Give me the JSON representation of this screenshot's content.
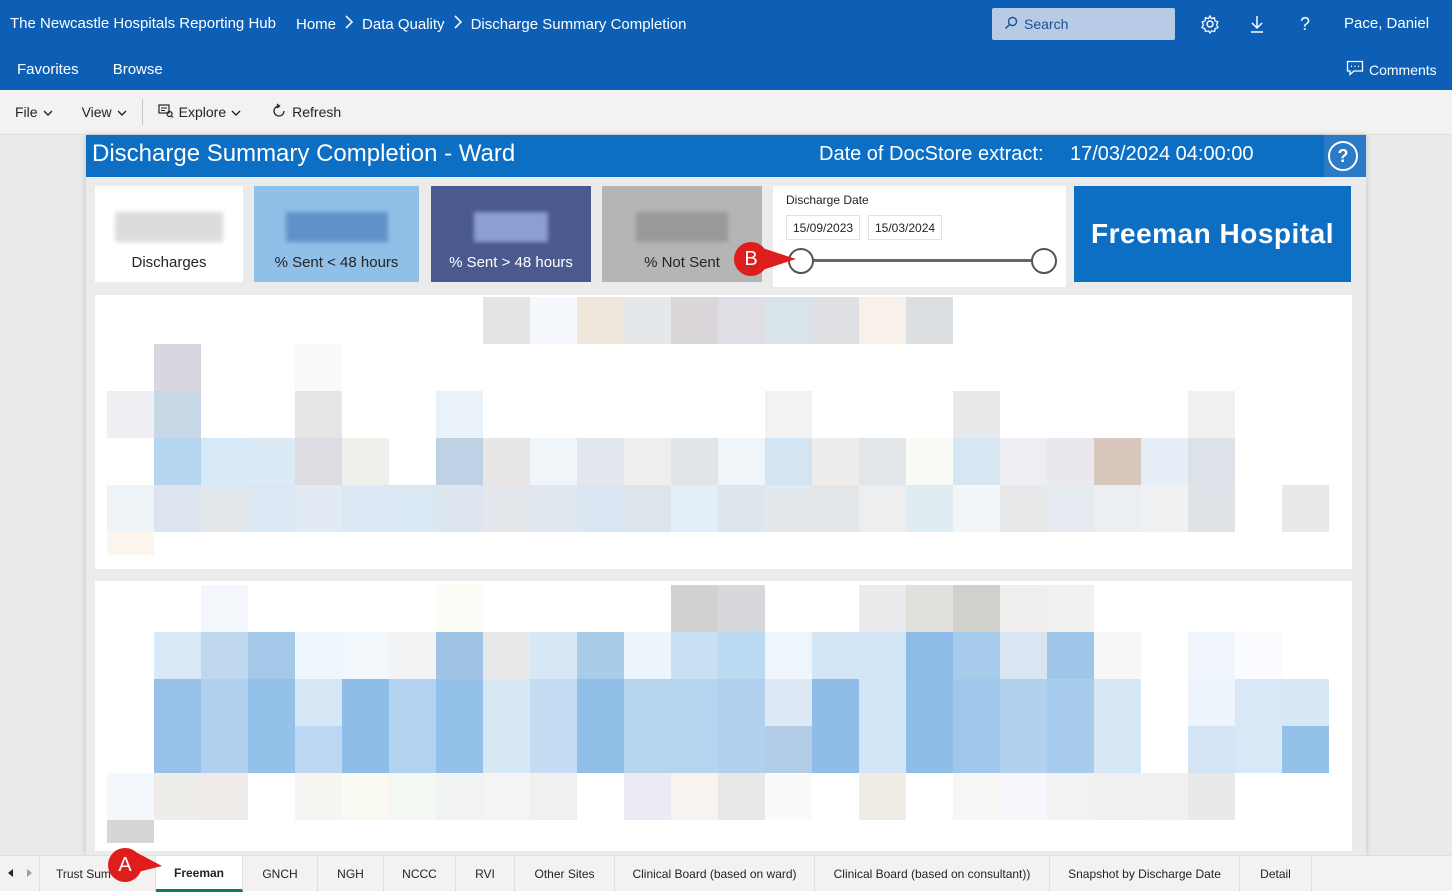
{
  "app": {
    "title": "The Newcastle Hospitals Reporting Hub",
    "breadcrumbs": [
      "Home",
      "Data Quality",
      "Discharge Summary Completion"
    ],
    "search_placeholder": "Search",
    "user": "Pace, Daniel",
    "nav": [
      "Favorites",
      "Browse"
    ],
    "comments_label": "Comments"
  },
  "toolbar": {
    "file": "File",
    "view": "View",
    "explore": "Explore",
    "refresh": "Refresh"
  },
  "report": {
    "title": "Discharge Summary Completion - Ward",
    "extract_label": "Date of DocStore extract:",
    "extract_value": "17/03/2024 04:00:00",
    "help_glyph": "?",
    "kpis": [
      {
        "label": "Discharges"
      },
      {
        "label": "% Sent < 48 hours"
      },
      {
        "label": "% Sent > 48 hours"
      },
      {
        "label": "% Not Sent"
      }
    ],
    "slicer": {
      "title": "Discharge Date",
      "start": "15/09/2023",
      "end": "15/03/2024"
    },
    "hospital": "Freeman Hospital"
  },
  "tabs": [
    {
      "label": "Trust Sum"
    },
    {
      "label": "Freeman",
      "active": true
    },
    {
      "label": "GNCH"
    },
    {
      "label": "NGH"
    },
    {
      "label": "NCCC"
    },
    {
      "label": "RVI"
    },
    {
      "label": "Other Sites"
    },
    {
      "label": "Clinical Board (based on ward)"
    },
    {
      "label": "Clinical Board (based on consultant))"
    },
    {
      "label": "Snapshot by Discharge Date"
    },
    {
      "label": "Detail"
    }
  ],
  "annotations": {
    "a": "A",
    "b": "B"
  },
  "colors": {
    "brand": "#0c5fb5",
    "header_blue": "#0c6fc4",
    "kpi_sent_lt48": "#90bfe7",
    "kpi_sent_gt48": "#4a5a8e",
    "kpi_not_sent": "#b5b5b5",
    "marker_red": "#e01d1d",
    "active_tab_underline": "#117865"
  }
}
